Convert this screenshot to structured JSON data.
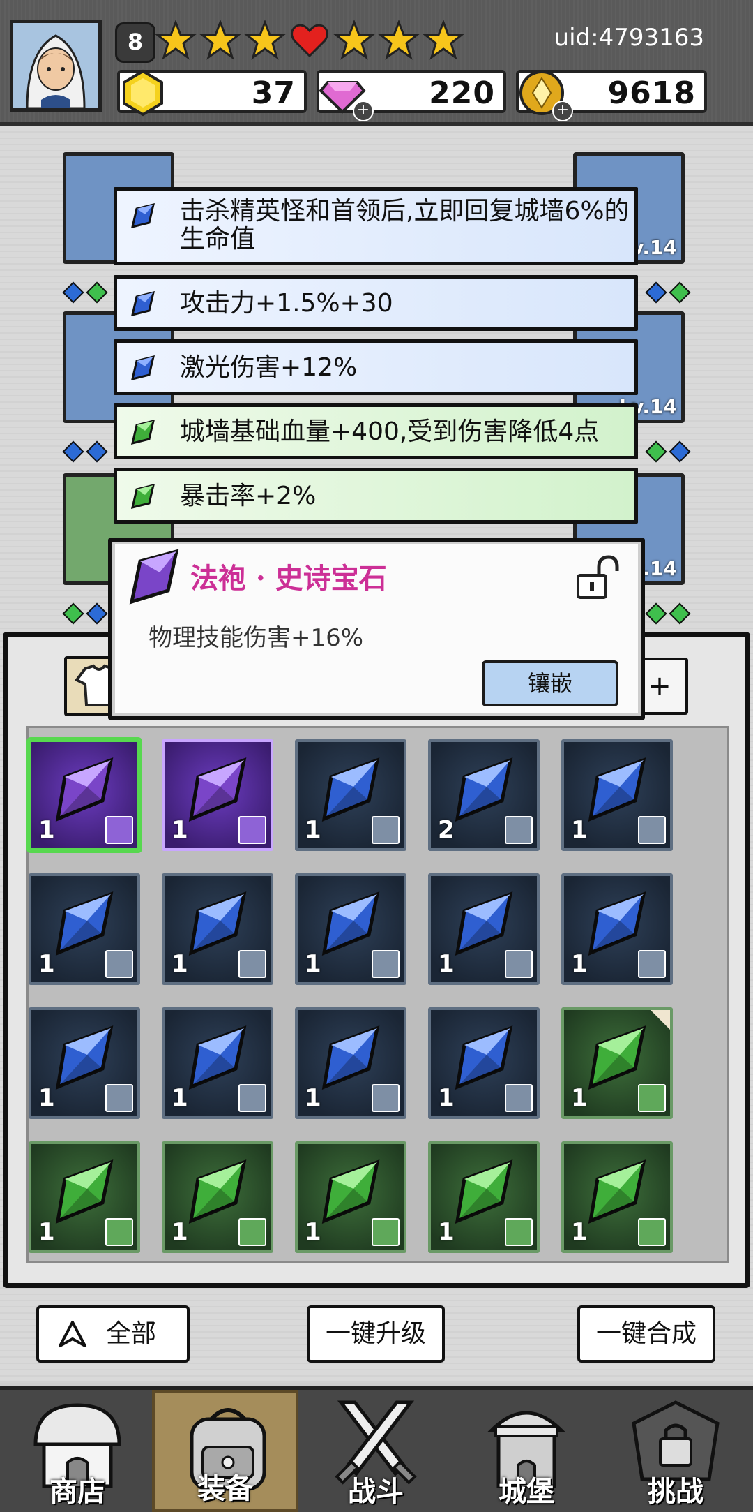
{
  "header": {
    "level": "8",
    "uid": "uid:4793163",
    "stars": [
      "star",
      "star",
      "star",
      "heart",
      "star",
      "star",
      "star"
    ],
    "resources": [
      {
        "name": "gold-gem",
        "value": "37",
        "has_plus": false
      },
      {
        "name": "diamond",
        "value": "220",
        "has_plus": true
      },
      {
        "name": "coin",
        "value": "9618",
        "has_plus": true
      }
    ]
  },
  "equipment": {
    "slot_level": "Lv.14"
  },
  "attributes": [
    {
      "color": "blue",
      "text": "击杀精英怪和首领后,立即回复城墙6%的生命值"
    },
    {
      "color": "blue",
      "text": "攻击力+1.5%+30"
    },
    {
      "color": "blue",
      "text": "激光伤害+12%"
    },
    {
      "color": "green",
      "text": "城墙基础血量+400,受到伤害降低4点"
    },
    {
      "color": "green",
      "text": "暴击率+2%"
    }
  ],
  "popup": {
    "title": "法袍 · 史诗宝石",
    "description": "物理技能伤害+16%",
    "inlay_button": "镶嵌"
  },
  "inventory": [
    {
      "color": "purple",
      "count": "1",
      "type": "robe",
      "selected": true
    },
    {
      "color": "purple",
      "count": "1",
      "type": "staff",
      "selected": false
    },
    {
      "color": "blue",
      "count": "1",
      "type": "ring",
      "selected": false
    },
    {
      "color": "blue",
      "count": "2",
      "type": "ring",
      "selected": false
    },
    {
      "color": "blue",
      "count": "1",
      "type": "robe",
      "selected": false
    },
    {
      "color": "blue",
      "count": "1",
      "type": "robe",
      "selected": false
    },
    {
      "color": "blue",
      "count": "1",
      "type": "boot",
      "selected": false
    },
    {
      "color": "blue",
      "count": "1",
      "type": "boot",
      "selected": false
    },
    {
      "color": "blue",
      "count": "1",
      "type": "staff",
      "selected": false
    },
    {
      "color": "blue",
      "count": "1",
      "type": "staff",
      "selected": false
    },
    {
      "color": "blue",
      "count": "1",
      "type": "amulet",
      "selected": false
    },
    {
      "color": "blue",
      "count": "1",
      "type": "amulet",
      "selected": false
    },
    {
      "color": "blue",
      "count": "1",
      "type": "bracelet",
      "selected": false
    },
    {
      "color": "blue",
      "count": "1",
      "type": "bracelet",
      "selected": false
    },
    {
      "color": "green",
      "count": "1",
      "type": "ring",
      "selected": false
    },
    {
      "color": "green",
      "count": "1",
      "type": "robe",
      "selected": false
    },
    {
      "color": "green",
      "count": "1",
      "type": "robe",
      "selected": false
    },
    {
      "color": "green",
      "count": "1",
      "type": "robe",
      "selected": false
    },
    {
      "color": "green",
      "count": "1",
      "type": "staff",
      "selected": false
    },
    {
      "color": "green",
      "count": "1",
      "type": "staff",
      "selected": false
    }
  ],
  "buttons": {
    "filter_all": "全部",
    "upgrade_all": "一键升级",
    "merge_all": "一键合成"
  },
  "nav": [
    {
      "id": "shop",
      "label": "商店",
      "active": false
    },
    {
      "id": "equipment",
      "label": "装备",
      "active": true
    },
    {
      "id": "battle",
      "label": "战斗",
      "active": false
    },
    {
      "id": "castle",
      "label": "城堡",
      "active": false
    },
    {
      "id": "challenge",
      "label": "挑战",
      "active": false
    }
  ],
  "colors": {
    "gem_blue": "#2f5fd1",
    "gem_green": "#3fae3a",
    "gem_purple": "#7a45c8",
    "title_pink": "#cc2f96"
  }
}
